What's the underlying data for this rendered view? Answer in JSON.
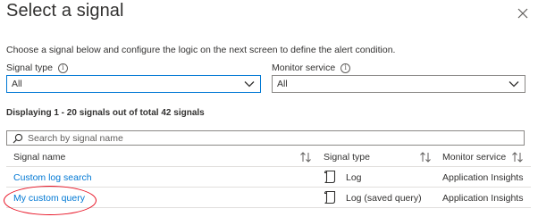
{
  "dialog": {
    "title": "Select a signal",
    "description": "Choose a signal below and configure the logic on the next screen to define the alert condition."
  },
  "filters": {
    "signal_type": {
      "label": "Signal type",
      "value": "All"
    },
    "monitor_service": {
      "label": "Monitor service",
      "value": "All"
    }
  },
  "info_glyph": "i",
  "results": {
    "summary": "Displaying 1 - 20 signals out of total 42 signals"
  },
  "search": {
    "placeholder": "Search by signal name"
  },
  "table": {
    "headers": {
      "signal_name": "Signal name",
      "signal_type": "Signal type",
      "monitor_service": "Monitor service"
    },
    "rows": [
      {
        "signal_name": "Custom log search",
        "signal_type": "Log",
        "monitor_service": "Application Insights",
        "icon": "log-icon"
      },
      {
        "signal_name": "My custom query",
        "signal_type": "Log (saved query)",
        "monitor_service": "Application Insights",
        "icon": "log-icon"
      }
    ]
  },
  "colors": {
    "accent": "#0078d4",
    "annotation": "#e81123",
    "text": "#323130",
    "border": "#8a8886"
  }
}
